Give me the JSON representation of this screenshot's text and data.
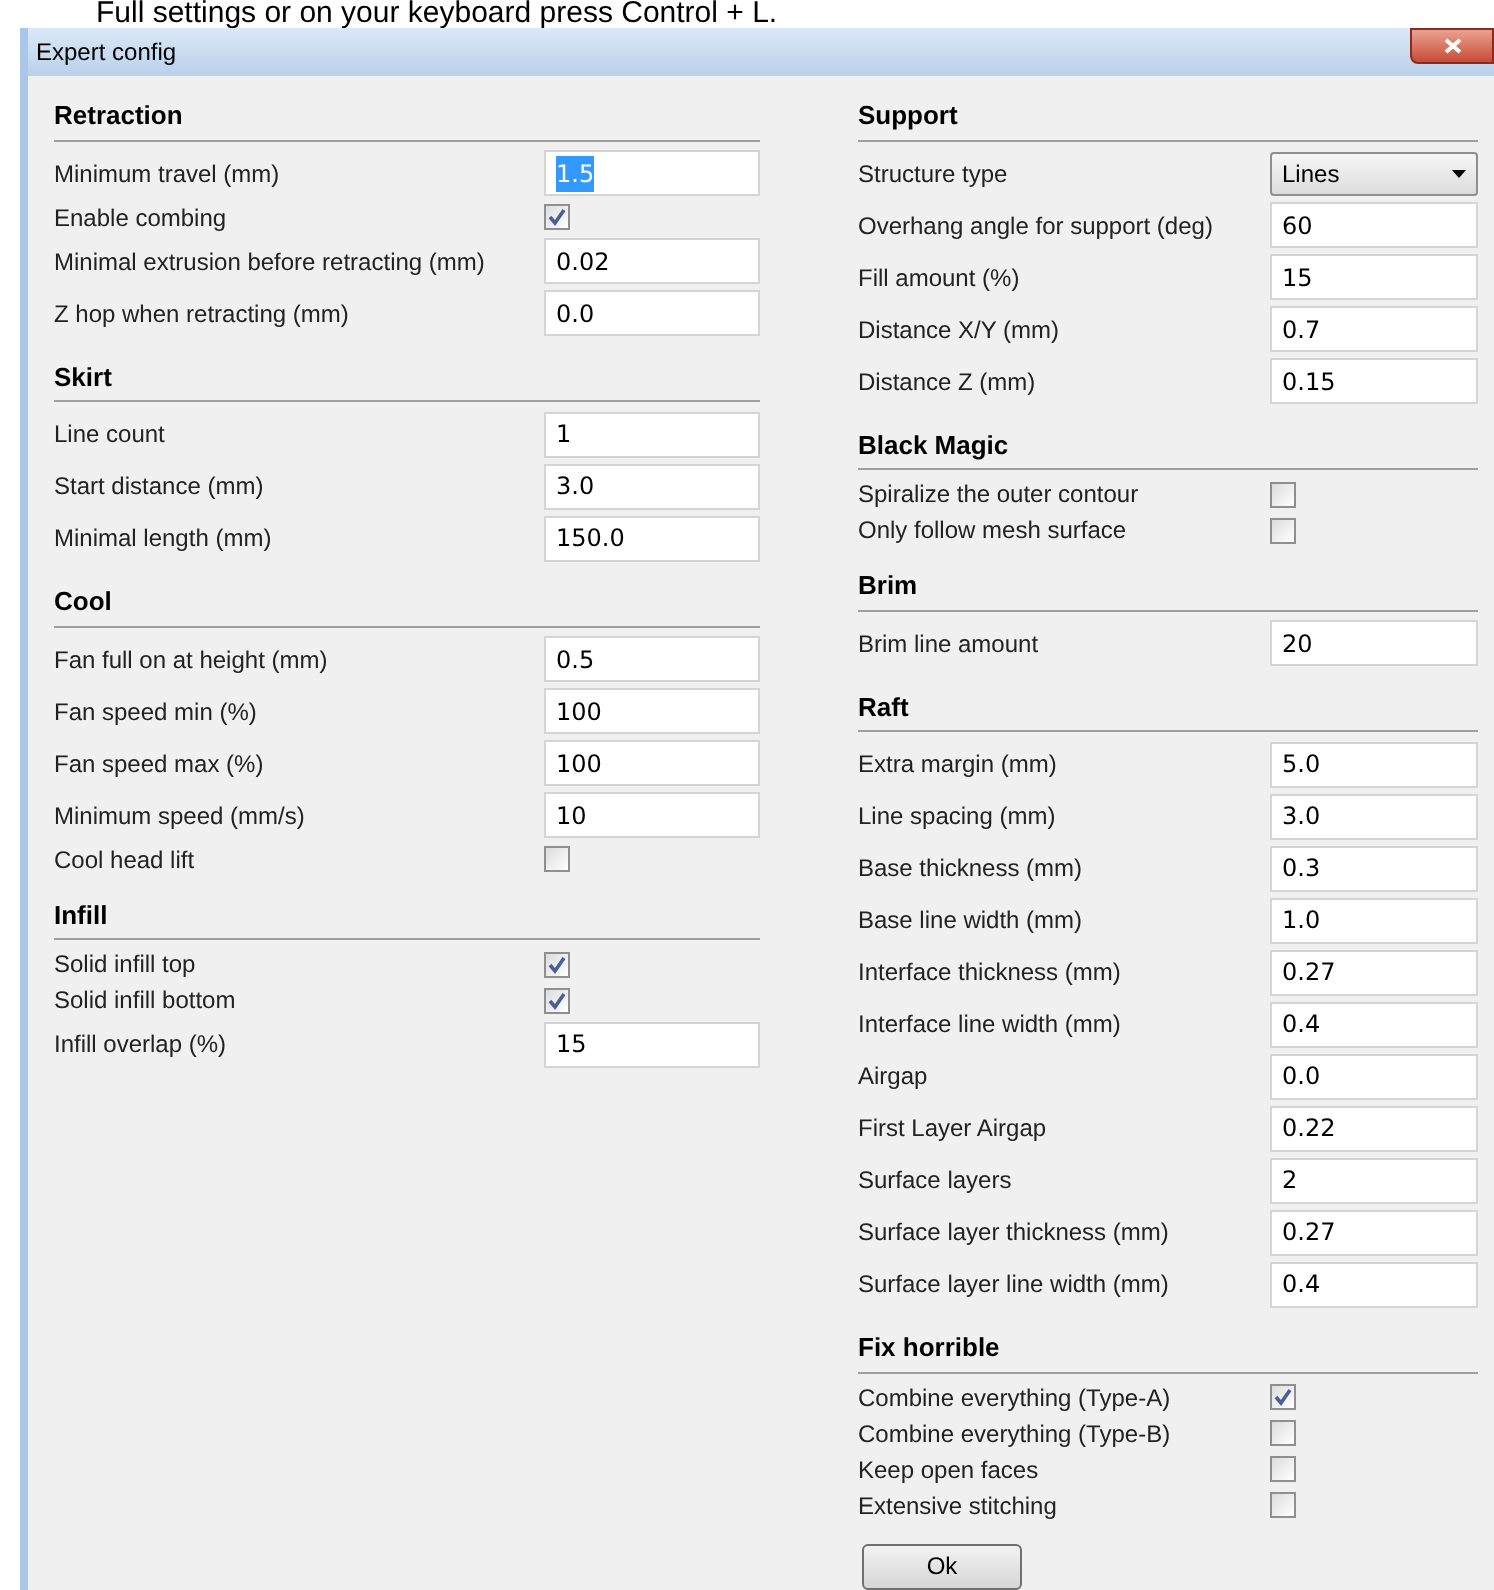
{
  "caption": "Full settings or on your keyboard press Control + L.",
  "window": {
    "title": "Expert config"
  },
  "columns": [
    {
      "sections": [
        {
          "title": "Retraction",
          "items": [
            {
              "kind": "text",
              "label": "Minimum travel (mm)",
              "value": "1.5",
              "focused": true
            },
            {
              "kind": "check",
              "label": "Enable combing",
              "checked": true
            },
            {
              "kind": "text",
              "label": "Minimal extrusion before retracting (mm)",
              "value": "0.02",
              "focused": false
            },
            {
              "kind": "text",
              "label": "Z hop when retracting (mm)",
              "value": "0.0",
              "focused": false
            }
          ]
        },
        {
          "title": "Skirt",
          "items": [
            {
              "kind": "text",
              "label": "Line count",
              "value": "1",
              "focused": false
            },
            {
              "kind": "text",
              "label": "Start distance (mm)",
              "value": "3.0",
              "focused": false
            },
            {
              "kind": "text",
              "label": "Minimal length (mm)",
              "value": "150.0",
              "focused": false
            }
          ]
        },
        {
          "title": "Cool",
          "items": [
            {
              "kind": "text",
              "label": "Fan full on at height (mm)",
              "value": "0.5",
              "focused": false
            },
            {
              "kind": "text",
              "label": "Fan speed min (%)",
              "value": "100",
              "focused": false
            },
            {
              "kind": "text",
              "label": "Fan speed max (%)",
              "value": "100",
              "focused": false
            },
            {
              "kind": "text",
              "label": "Minimum speed (mm/s)",
              "value": "10",
              "focused": false
            },
            {
              "kind": "check",
              "label": "Cool head lift",
              "checked": false
            }
          ]
        },
        {
          "title": "Infill",
          "items": [
            {
              "kind": "check",
              "label": "Solid infill top",
              "checked": true
            },
            {
              "kind": "check",
              "label": "Solid infill bottom",
              "checked": true
            },
            {
              "kind": "text",
              "label": "Infill overlap (%)",
              "value": "15",
              "focused": false
            }
          ]
        }
      ]
    },
    {
      "sections": [
        {
          "title": "Support",
          "items": [
            {
              "kind": "select",
              "label": "Structure type",
              "value": "Lines"
            },
            {
              "kind": "text",
              "label": "Overhang angle for support (deg)",
              "value": "60",
              "focused": false
            },
            {
              "kind": "text",
              "label": "Fill amount (%)",
              "value": "15",
              "focused": false
            },
            {
              "kind": "text",
              "label": "Distance X/Y (mm)",
              "value": "0.7",
              "focused": false
            },
            {
              "kind": "text",
              "label": "Distance Z (mm)",
              "value": "0.15",
              "focused": false
            }
          ]
        },
        {
          "title": "Black Magic",
          "items": [
            {
              "kind": "check",
              "label": "Spiralize the outer contour",
              "checked": false
            },
            {
              "kind": "check",
              "label": "Only follow mesh surface",
              "checked": false
            }
          ]
        },
        {
          "title": "Brim",
          "items": [
            {
              "kind": "text",
              "label": "Brim line amount",
              "value": "20",
              "focused": false
            }
          ]
        },
        {
          "title": "Raft",
          "items": [
            {
              "kind": "text",
              "label": "Extra margin (mm)",
              "value": "5.0",
              "focused": false
            },
            {
              "kind": "text",
              "label": "Line spacing (mm)",
              "value": "3.0",
              "focused": false
            },
            {
              "kind": "text",
              "label": "Base thickness (mm)",
              "value": "0.3",
              "focused": false
            },
            {
              "kind": "text",
              "label": "Base line width (mm)",
              "value": "1.0",
              "focused": false
            },
            {
              "kind": "text",
              "label": "Interface thickness (mm)",
              "value": "0.27",
              "focused": false
            },
            {
              "kind": "text",
              "label": "Interface line width (mm)",
              "value": "0.4",
              "focused": false
            },
            {
              "kind": "text",
              "label": "Airgap",
              "value": "0.0",
              "focused": false
            },
            {
              "kind": "text",
              "label": "First Layer Airgap",
              "value": "0.22",
              "focused": false
            },
            {
              "kind": "text",
              "label": "Surface layers",
              "value": "2",
              "focused": false
            },
            {
              "kind": "text",
              "label": "Surface layer thickness (mm)",
              "value": "0.27",
              "focused": false
            },
            {
              "kind": "text",
              "label": "Surface layer line width (mm)",
              "value": "0.4",
              "focused": false
            }
          ]
        },
        {
          "title": "Fix horrible",
          "items": [
            {
              "kind": "check",
              "label": "Combine everything (Type-A)",
              "checked": true
            },
            {
              "kind": "check",
              "label": "Combine everything (Type-B)",
              "checked": false
            },
            {
              "kind": "check",
              "label": "Keep open faces",
              "checked": false
            },
            {
              "kind": "check",
              "label": "Extensive stitching",
              "checked": false
            }
          ]
        }
      ]
    }
  ],
  "buttons": [
    {
      "label": "Ok"
    }
  ]
}
